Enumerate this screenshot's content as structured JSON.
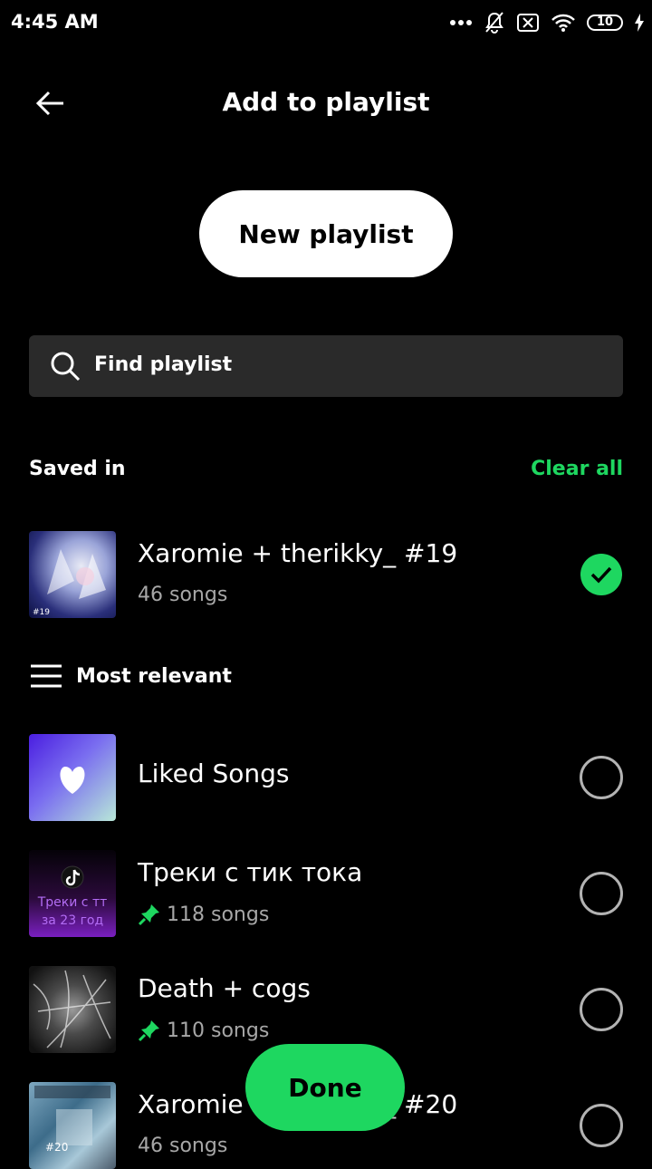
{
  "status_bar": {
    "time": "4:45 AM",
    "battery": "10"
  },
  "header": {
    "title": "Add to playlist"
  },
  "new_playlist_label": "New playlist",
  "search": {
    "placeholder": "Find playlist"
  },
  "saved_in": {
    "label": "Saved in",
    "clear_all": "Clear all",
    "items": [
      {
        "title": "Xaromie + therikky_ #19",
        "subtitle": "46 songs",
        "selected": true,
        "thumb_text": "#19"
      }
    ]
  },
  "sort": {
    "label": "Most relevant"
  },
  "playlists": [
    {
      "title": "Liked Songs",
      "subtitle": "",
      "pinned": false,
      "selected": false
    },
    {
      "title": "Треки с тик тока",
      "subtitle": "118 songs",
      "pinned": true,
      "selected": false,
      "thumb_text": "Треки с тт за 23 год"
    },
    {
      "title": "Death + cogs",
      "subtitle": "110 songs",
      "pinned": true,
      "selected": false
    },
    {
      "title": "Xaromie + therikky_ #20",
      "subtitle": "46 songs",
      "pinned": false,
      "selected": false,
      "thumb_text": "#20"
    }
  ],
  "done_label": "Done",
  "colors": {
    "accent": "#1ed760",
    "background": "#000000",
    "search_bg": "#2a2a2a"
  }
}
